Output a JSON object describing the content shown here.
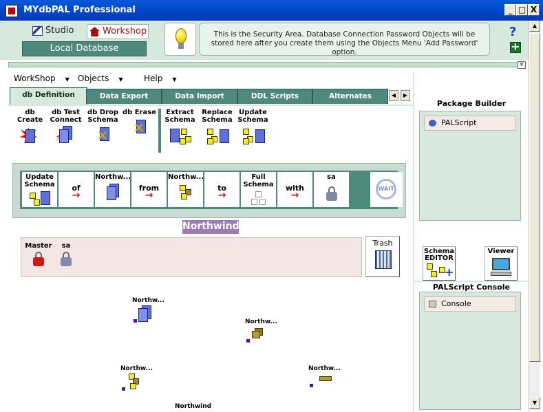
{
  "window": {
    "title": "MYdbPAL Professional",
    "minimize": "_",
    "maximize": "□",
    "close": "X"
  },
  "header": {
    "studio_label": "Studio",
    "workshop_label": "Workshop",
    "local_database": "Local Database",
    "info_text": "This is the Security Area. Database Connection Password Objects will be stored here after you create them using the Objects Menu 'Add Password' option.",
    "help_glyph": "?"
  },
  "menus": [
    {
      "label": "WorkShop"
    },
    {
      "label": "Objects"
    },
    {
      "label": "Help"
    }
  ],
  "tabs": [
    {
      "label": "db Definition",
      "active": true
    },
    {
      "label": "Data Export"
    },
    {
      "label": "Data Import"
    },
    {
      "label": "DDL Scripts"
    },
    {
      "label": "Alternates"
    }
  ],
  "tools": [
    {
      "label": "db Create",
      "icon": "db-create-icon"
    },
    {
      "label": "db Test Connect",
      "icon": "db-test-connect-icon"
    },
    {
      "label": "db Drop Schema",
      "icon": "db-drop-schema-icon"
    },
    {
      "label": "db Erase",
      "icon": "db-erase-icon"
    },
    {
      "label": "Extract Schema",
      "icon": "extract-schema-icon"
    },
    {
      "label": "Replace Schema",
      "icon": "replace-schema-icon"
    },
    {
      "label": "Update Schema",
      "icon": "update-schema-icon"
    }
  ],
  "pipeline": [
    {
      "label": "Update Schema",
      "type": "icon"
    },
    {
      "label": "of",
      "type": "arrow"
    },
    {
      "label": "Northw...",
      "type": "icon"
    },
    {
      "label": "from",
      "type": "arrow"
    },
    {
      "label": "Northw...",
      "type": "icon"
    },
    {
      "label": "to",
      "type": "arrow"
    },
    {
      "label": "Full Schema",
      "type": "icon"
    },
    {
      "label": "with",
      "type": "arrow"
    },
    {
      "label": "sa",
      "type": "icon"
    }
  ],
  "wait_label": "WAIT",
  "database_name": "Northwind",
  "users": [
    {
      "label": "Master",
      "color": "#d01818"
    },
    {
      "label": "sa",
      "color": "#7f8aa8"
    }
  ],
  "trash_label": "Trash",
  "canvas_objects": [
    {
      "label": "Northw...",
      "icon": "database-icon"
    },
    {
      "label": "Northw...",
      "icon": "schema-icon"
    },
    {
      "label": "Northw...",
      "icon": "tables-icon"
    },
    {
      "label": "Northw...",
      "icon": "table-icon"
    },
    {
      "label": "Northwind",
      "icon": "database-icon"
    }
  ],
  "right_panel": {
    "package_builder_title": "Package Builder",
    "palscript_item": "PALScript",
    "schema_editor_label": "Schema EDITOR",
    "viewer_label": "Viewer",
    "console_title": "PALScript Console",
    "console_item": "Console"
  },
  "colors": {
    "titlebar": "#0043c7",
    "accent_green": "#4d8a7c",
    "panel_light": "#d7e9df",
    "name_badge": "#9e7bb3"
  }
}
